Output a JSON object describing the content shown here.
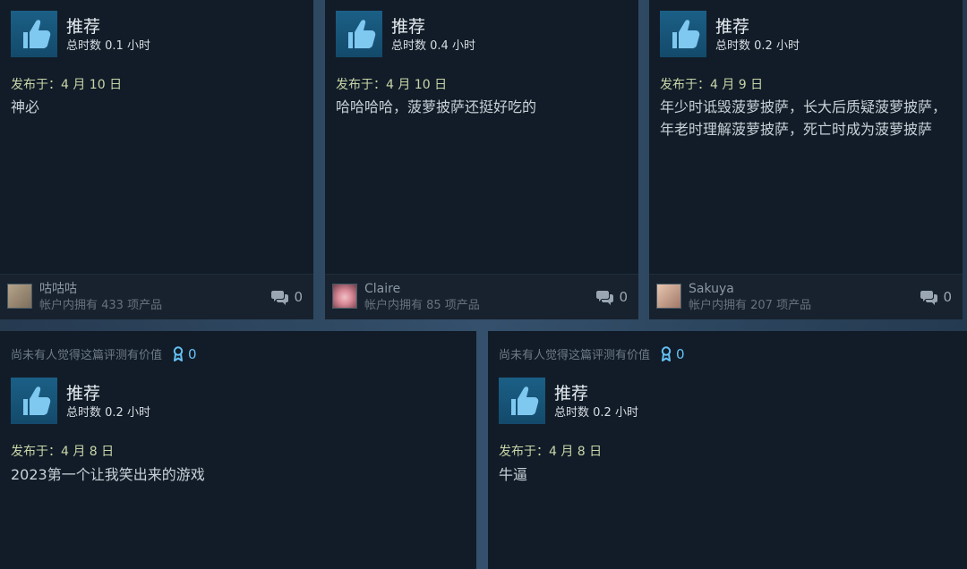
{
  "reviews_top": [
    {
      "title": "推荐",
      "hours": "总时数 0.1 小时",
      "date": "发布于：4 月 10 日",
      "body": [
        "神必"
      ],
      "user": "咕咕咕",
      "owned": "帐户内拥有 433 项产品",
      "comments": "0"
    },
    {
      "title": "推荐",
      "hours": "总时数 0.4 小时",
      "date": "发布于：4 月 10 日",
      "body": [
        "哈哈哈哈，菠萝披萨还挺好吃的"
      ],
      "user": "Claire",
      "owned": "帐户内拥有 85 项产品",
      "comments": "0"
    },
    {
      "title": "推荐",
      "hours": "总时数 0.2 小时",
      "date": "发布于：4 月 9 日",
      "body": [
        "年少时诋毁菠萝披萨，长大后质疑菠萝披萨，",
        "年老时理解菠萝披萨，死亡时成为菠萝披萨"
      ],
      "user": "Sakuya",
      "owned": "帐户内拥有 207 项产品",
      "comments": "0"
    }
  ],
  "reviews_bottom": [
    {
      "helpful_text": "尚未有人觉得这篇评测有价值",
      "awards": "0",
      "title": "推荐",
      "hours": "总时数 0.2 小时",
      "date": "发布于：4 月 8 日",
      "body": [
        "2023第一个让我笑出来的游戏"
      ]
    },
    {
      "helpful_text": "尚未有人觉得这篇评测有价值",
      "awards": "0",
      "title": "推荐",
      "hours": "总时数 0.2 小时",
      "date": "发布于：4 月 8 日",
      "body": [
        "牛逼"
      ]
    }
  ],
  "icons": {
    "recommend": "thumbs-up-icon",
    "comments": "comment-bubble-icon",
    "award": "award-ribbon-icon"
  },
  "colors": {
    "card_bg": "#111c28",
    "footer_bg": "#17222e",
    "thumb_blue": "#1b5f86",
    "award_blue": "#66c0f4",
    "date_green": "#c9d5a8"
  }
}
